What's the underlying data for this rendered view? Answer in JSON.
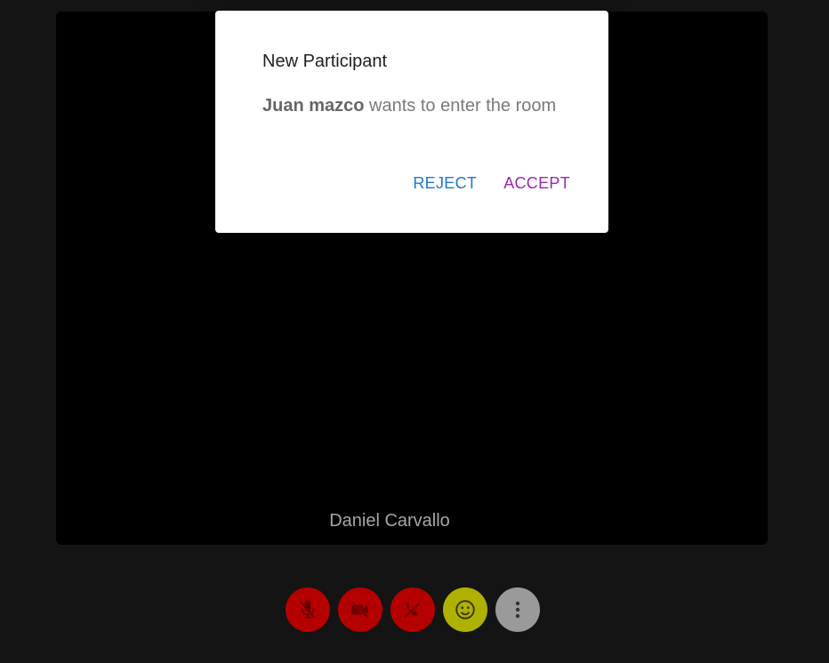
{
  "dialog": {
    "title": "New Participant",
    "requester_name": "Juan mazco",
    "message": " wants to enter the room",
    "reject_label": "REJECT",
    "accept_label": "ACCEPT"
  },
  "video": {
    "participant_name": "Daniel Carvallo"
  },
  "toolbar": {
    "buttons": [
      {
        "icon": "mic-off-icon",
        "color": "#b50000"
      },
      {
        "icon": "videocam-off-icon",
        "color": "#b50000"
      },
      {
        "icon": "call-end-icon",
        "color": "#b50000"
      },
      {
        "icon": "emoji-icon",
        "color": "#b0b000"
      },
      {
        "icon": "more-vert-icon",
        "color": "#9a9a9a"
      }
    ]
  },
  "colors": {
    "background": "#141414",
    "stage": "#000000",
    "reject": "#1f78d1",
    "accept": "#9c27b0"
  }
}
